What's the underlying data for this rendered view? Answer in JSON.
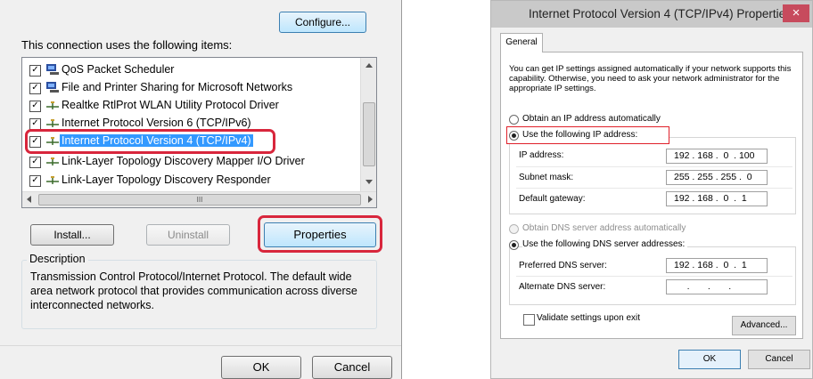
{
  "left_panel": {
    "configure_label": "Configure...",
    "uses_label": "This connection uses the following items:",
    "items": [
      {
        "label": "QoS Packet Scheduler",
        "checked": "✓",
        "icon": "network-service-icon"
      },
      {
        "label": "File and Printer Sharing for Microsoft Networks",
        "checked": "✓",
        "icon": "network-service-icon"
      },
      {
        "label": "Realtke RtlProt WLAN Utility Protocol Driver",
        "checked": "✓",
        "icon": "protocol-icon"
      },
      {
        "label": "Internet Protocol Version 6 (TCP/IPv6)",
        "checked": "✓",
        "icon": "protocol-icon"
      },
      {
        "label": "Internet Protocol Version 4 (TCP/IPv4)",
        "checked": "✓",
        "icon": "protocol-icon"
      },
      {
        "label": "Link-Layer Topology Discovery Mapper I/O Driver",
        "checked": "✓",
        "icon": "protocol-icon"
      },
      {
        "label": "Link-Layer Topology Discovery Responder",
        "checked": "✓",
        "icon": "protocol-icon"
      }
    ],
    "hscroll_mark": "III",
    "install_label": "Install...",
    "uninstall_label": "Uninstall",
    "properties_label": "Properties",
    "description_title": "Description",
    "description_text": "Transmission Control Protocol/Internet Protocol. The default wide area network protocol that provides communication across diverse interconnected networks.",
    "ok_label": "OK",
    "cancel_label": "Cancel"
  },
  "dialog": {
    "title": "Internet Protocol Version 4 (TCP/IPv4) Properties",
    "close_glyph": "×",
    "tab_general": "General",
    "intro": "You can get IP settings assigned automatically if your network supports this capability. Otherwise, you need to ask your network administrator for the appropriate IP settings.",
    "obtain_ip_auto": "Obtain an IP address automatically",
    "use_following_ip": "Use the following IP address:",
    "ip_label": "IP address:",
    "ip_value": "192 . 168 .  0  . 100",
    "mask_label": "Subnet mask:",
    "mask_value": "255 . 255 . 255 .  0",
    "gateway_label": "Default gateway:",
    "gateway_value": "192 . 168 .  0  .  1",
    "obtain_dns_auto": "Obtain DNS server address automatically",
    "use_following_dns": "Use the following DNS server addresses:",
    "pref_dns_label": "Preferred DNS server:",
    "pref_dns_value": "192 . 168 .  0  .  1",
    "alt_dns_label": "Alternate DNS server:",
    "alt_dns_value": "     .       .       .",
    "validate_label": "Validate settings upon exit",
    "advanced_label": "Advanced...",
    "ok_label": "OK",
    "cancel_label": "Cancel"
  },
  "colors": {
    "highlight_box": "#d8263c",
    "selection": "#3399ff"
  }
}
